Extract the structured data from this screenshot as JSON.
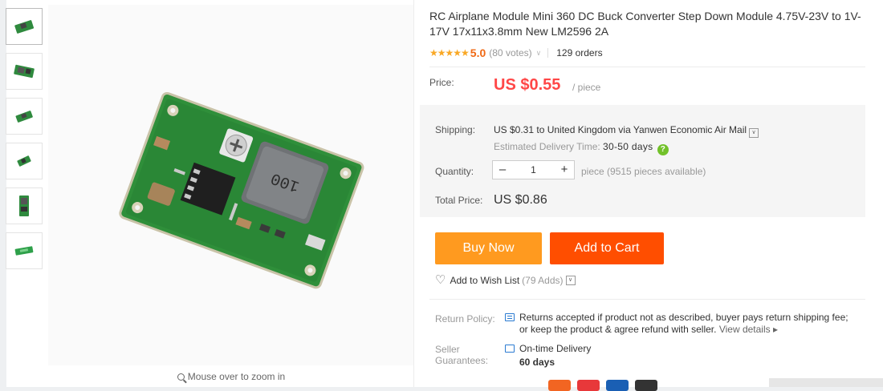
{
  "product": {
    "title": "RC Airplane Module Mini 360 DC Buck Converter Step Down Module 4.75V-23V to 1V-17V 17x11x3.8mm New LM2596 2A",
    "stars": "★★★★★",
    "rating": "5.0",
    "votes": "(80 votes)",
    "orders": "129 orders"
  },
  "gallery": {
    "zoom_hint": "Mouse over to zoom in",
    "inductor_marking": "100"
  },
  "price": {
    "label": "Price:",
    "value": "US $0.55",
    "unit": "/ piece"
  },
  "shipping": {
    "label": "Shipping:",
    "text": "US $0.31 to United Kingdom via Yanwen Economic Air Mail",
    "estimate_label": "Estimated Delivery Time:",
    "estimate_value": "30-50 days"
  },
  "quantity": {
    "label": "Quantity:",
    "value": "1",
    "minus": "–",
    "plus": "+",
    "note": "piece (9515 pieces available)"
  },
  "total": {
    "label": "Total Price:",
    "value": "US $0.86"
  },
  "actions": {
    "buy_now": "Buy Now",
    "add_to_cart": "Add to Cart",
    "wishlist": "Add to Wish List",
    "wishlist_count": "(79 Adds)"
  },
  "return_policy": {
    "label": "Return Policy:",
    "line1": "Returns accepted if product not as described, buyer pays return shipping fee;",
    "line2": "or keep the product & agree refund with seller.",
    "link": "View details ▸"
  },
  "guarantees": {
    "label_line1": "Seller",
    "label_line2": "Guarantees:",
    "title": "On-time Delivery",
    "days": "60 days"
  },
  "colors": {
    "price": "#ff4747",
    "buy_now": "#ff9a1f",
    "add_to_cart": "#ff4e00",
    "stars": "#f9a825"
  }
}
